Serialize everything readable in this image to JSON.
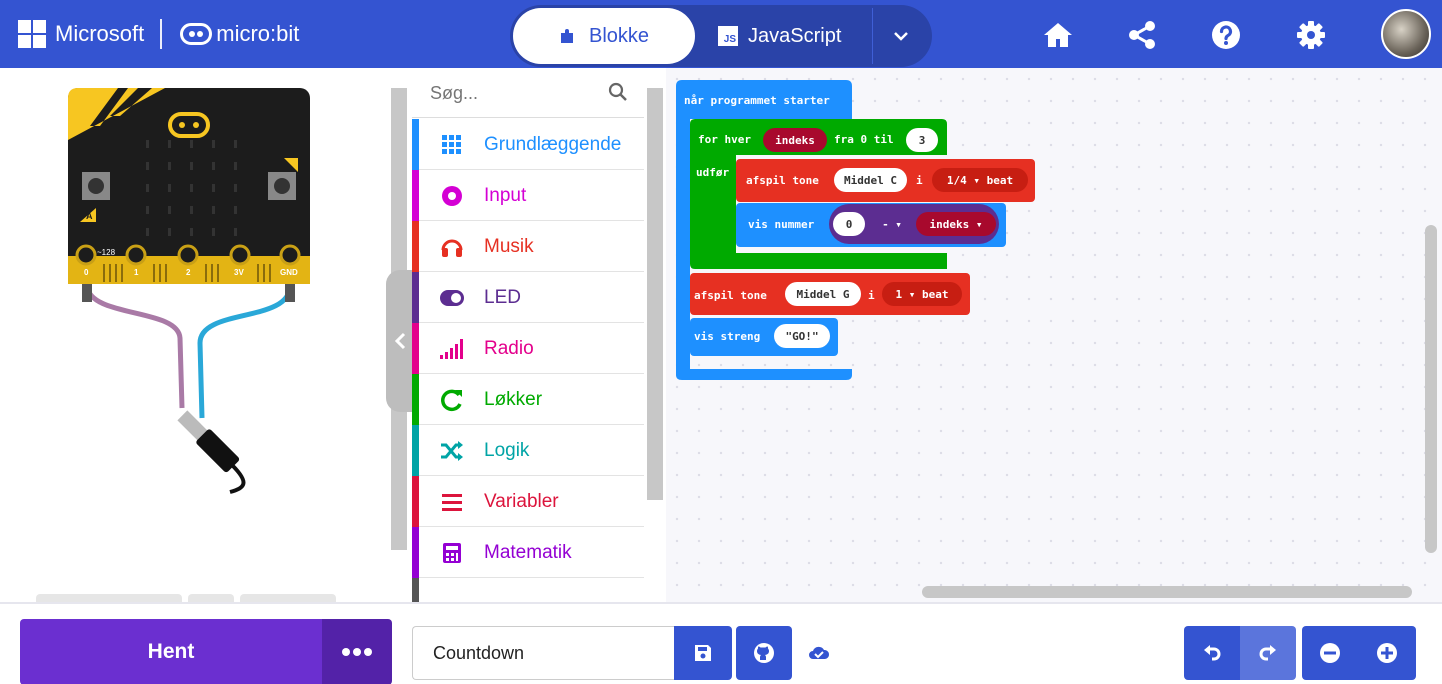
{
  "header": {
    "brand_microsoft": "Microsoft",
    "brand_microbit": "micro:bit",
    "tab_blocks": "Blokke",
    "tab_javascript": "JavaScript",
    "js_badge": "JS",
    "icons": [
      "home-icon",
      "share-icon",
      "help-icon",
      "settings-icon",
      "avatar"
    ]
  },
  "simulator": {
    "button_a": "A",
    "button_b": "B",
    "pins": [
      "0",
      "1",
      "2",
      "3V",
      "GND"
    ],
    "pin_note": "~128"
  },
  "toolbox": {
    "search_placeholder": "Søg...",
    "categories": [
      {
        "label": "Grundlæggende",
        "color": "#1e90ff",
        "icon": "grid-icon"
      },
      {
        "label": "Input",
        "color": "#d400d4",
        "icon": "input-circle-icon"
      },
      {
        "label": "Musik",
        "color": "#e63022",
        "icon": "headphones-icon"
      },
      {
        "label": "LED",
        "color": "#5c2d91",
        "icon": "toggle-icon"
      },
      {
        "label": "Radio",
        "color": "#e3008c",
        "icon": "signal-bars-icon"
      },
      {
        "label": "Løkker",
        "color": "#00aa00",
        "icon": "loop-arrow-icon"
      },
      {
        "label": "Logik",
        "color": "#00a4a6",
        "icon": "shuffle-icon"
      },
      {
        "label": "Variabler",
        "color": "#dc143c",
        "icon": "list-lines-icon"
      },
      {
        "label": "Matematik",
        "color": "#9400d3",
        "icon": "calculator-icon"
      }
    ]
  },
  "workspace": {
    "on_start": "når programmet starter",
    "for_label": "for hver",
    "for_var": "indeks",
    "for_from": "fra 0 til",
    "for_to": "3",
    "do_label": "udfør",
    "tone1_label": "afspil tone",
    "tone1_note": "Middel C",
    "tone1_sep": "i",
    "tone1_beat": "1/4 ▾ beat",
    "show_number_label": "vis nummer",
    "minus_left": "0",
    "minus_op": "- ▾",
    "minus_right": "indeks ▾",
    "tone2_label": "afspil tone",
    "tone2_note": "Middel G",
    "tone2_sep": "i",
    "tone2_beat": "1 ▾ beat",
    "show_string_label": "vis streng",
    "show_string_value": "GO!"
  },
  "colors": {
    "header": "#3454d1",
    "basic": "#1e90ff",
    "loops": "#00aa00",
    "music": "#e63022",
    "variables": "#a8092d",
    "math": "#9400d3",
    "download": "#6b2fd0"
  },
  "bottombar": {
    "download_label": "Hent",
    "project_name": "Countdown"
  }
}
